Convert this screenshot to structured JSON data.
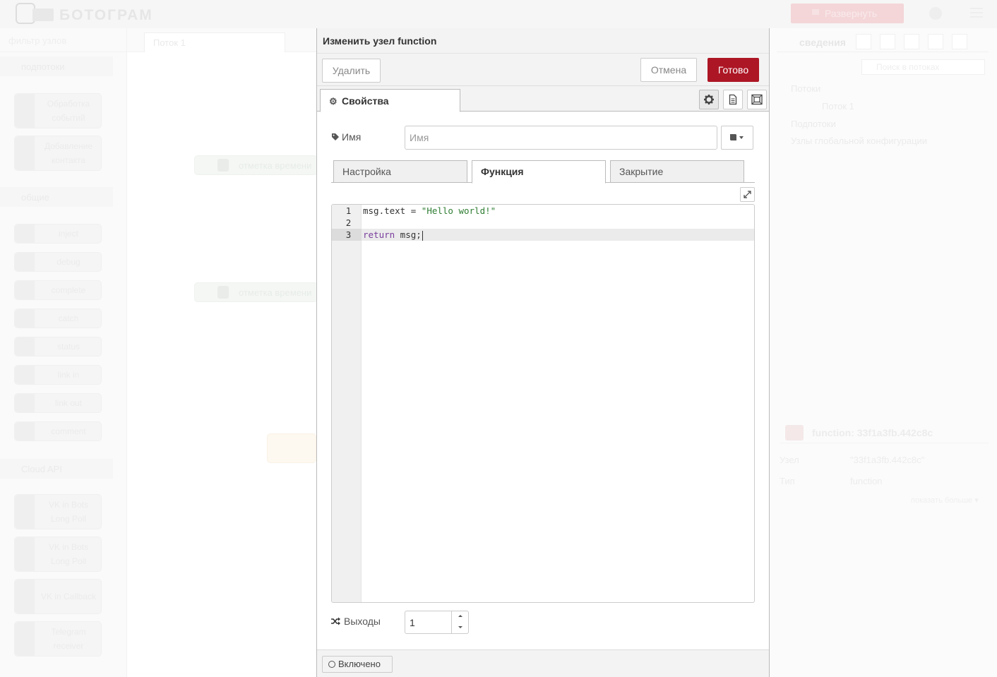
{
  "header": {
    "app_name": "БОТОГРАМ",
    "deploy_label": "Развернуть"
  },
  "palette": {
    "filter_placeholder": "фильтр узлов",
    "categories": [
      {
        "label": "подпотоки"
      },
      {
        "label": "общие"
      },
      {
        "label": "Cloud API"
      }
    ],
    "nodes": [
      {
        "label": "Обработка событий"
      },
      {
        "label": "Добавление контакта"
      },
      {
        "label": "inject"
      },
      {
        "label": "debug"
      },
      {
        "label": "complete"
      },
      {
        "label": "catch"
      },
      {
        "label": "status"
      },
      {
        "label": "link in"
      },
      {
        "label": "link out"
      },
      {
        "label": "comment"
      },
      {
        "label": "VK in Bots Long Poll"
      },
      {
        "label": "VK in Bots Long Poll"
      },
      {
        "label": "VK in Callback"
      },
      {
        "label": "Telegram receiver"
      }
    ]
  },
  "workspace": {
    "tab_label": "Поток 1",
    "nodes": [
      {
        "label": "отметка времени"
      },
      {
        "label": "отметка времени"
      }
    ]
  },
  "sidebar": {
    "title": "сведения",
    "filter_placeholder": "Поиск в потоках",
    "tree": [
      "Потоки",
      "Поток 1",
      "Подпотоки",
      "Узлы глобальной конфигурации"
    ],
    "info_title": "function: 33f1a3fb.442c8c",
    "info_rows": [
      {
        "key": "Узел",
        "value": "\"33f1a3fb.442c8c\""
      },
      {
        "key": "Тип",
        "value": "function"
      }
    ],
    "show_more": "показать больше ▾"
  },
  "dialog": {
    "title": "Изменить узел function",
    "delete_label": "Удалить",
    "cancel_label": "Отмена",
    "done_label": "Готово",
    "properties_tab": "Свойства",
    "name_label": "Имя",
    "name_value": "",
    "name_placeholder": "Имя",
    "sub_tabs": [
      {
        "label": "Настройка",
        "active": false
      },
      {
        "label": "Функция",
        "active": true
      },
      {
        "label": "Закрытие",
        "active": false
      }
    ],
    "code_lines": [
      {
        "number": "1",
        "text": "msg.text = \"Hello world!\""
      },
      {
        "number": "2",
        "text": ""
      },
      {
        "number": "3",
        "text": "return msg;"
      }
    ],
    "outputs_label": "Выходы",
    "outputs_value": "1",
    "enabled_label": "Включено"
  },
  "colors": {
    "primary_button": "#ad1625",
    "code_string": "#2e7d32",
    "code_keyword": "#7a3e9d"
  }
}
